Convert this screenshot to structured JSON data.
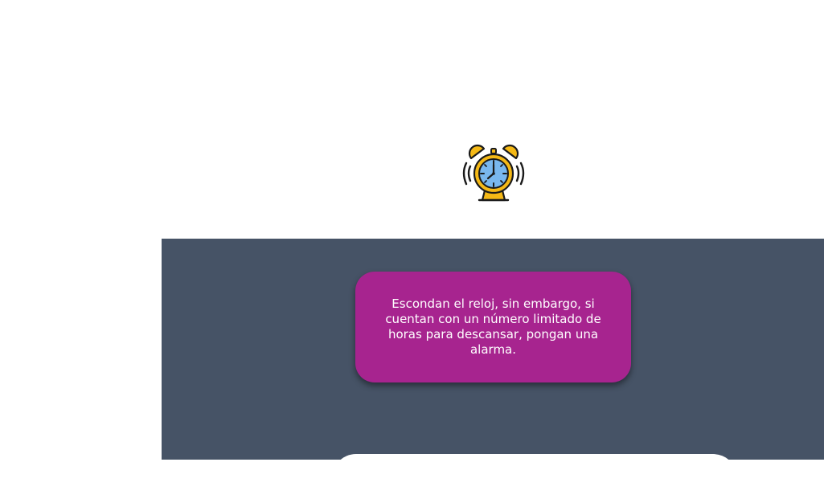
{
  "tip": {
    "text": "Escondan el reloj, sin embargo, si cuentan con un número limitado de horas para descansar, pongan una alarma."
  },
  "icons": {
    "clock": "alarm-clock-icon"
  },
  "colors": {
    "background": "#ffffff",
    "panel": "#465366",
    "tip_card": "#a7248f",
    "tip_text": "#ffffff",
    "clock_body": "#f5b916",
    "clock_face": "#79b7ee",
    "outline": "#1a1a1a"
  }
}
